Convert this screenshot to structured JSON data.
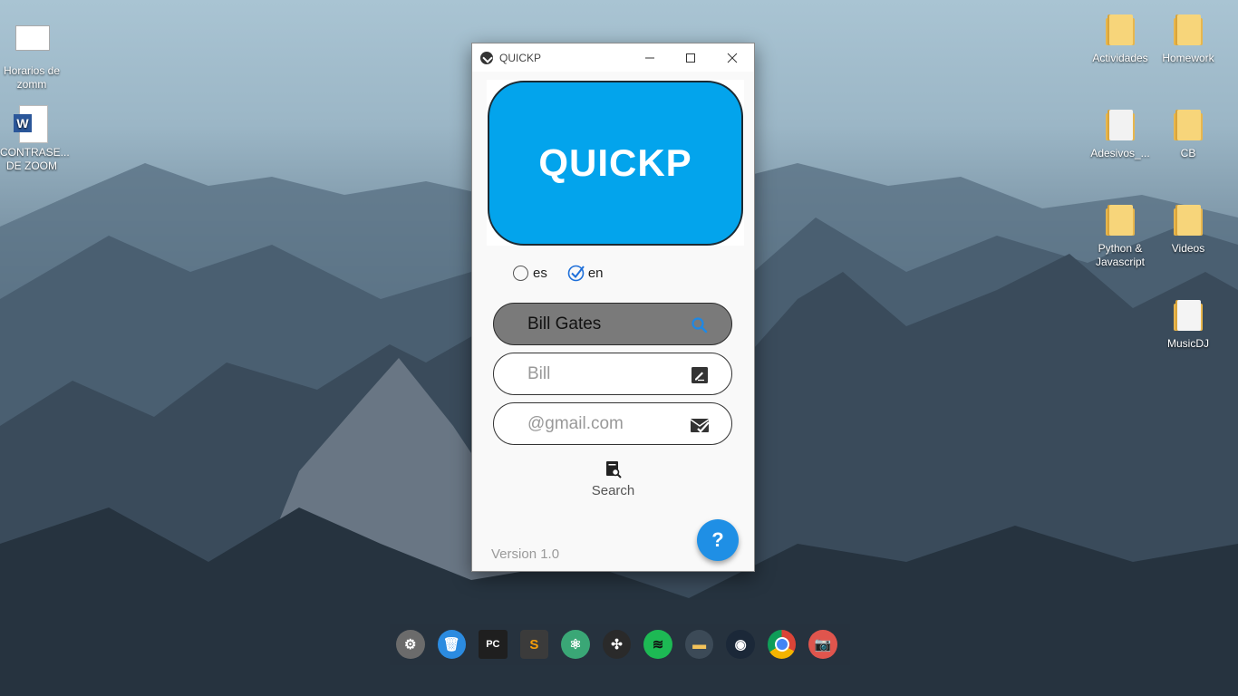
{
  "desktop": {
    "left_icons": [
      {
        "label": "Horarios de zomm",
        "icon": "document-icon"
      },
      {
        "label": "CONTRASE... DE ZOOM",
        "icon": "word-document-icon"
      }
    ],
    "right_icons": [
      {
        "label": "Actividades",
        "icon": "folder-icon"
      },
      {
        "label": "Homework",
        "icon": "folder-icon"
      },
      {
        "label": "Adesivos_...",
        "icon": "folder-icon"
      },
      {
        "label": "CB",
        "icon": "folder-icon"
      },
      {
        "label": "Python & Javascript",
        "icon": "folder-icon"
      },
      {
        "label": "Videos",
        "icon": "folder-icon"
      },
      {
        "label": "MusicDJ",
        "icon": "folder-icon"
      }
    ]
  },
  "window": {
    "title": "QUICKP",
    "logo_text": "QUICKP",
    "languages": [
      {
        "label": "es",
        "checked": false
      },
      {
        "label": "en",
        "checked": true
      }
    ],
    "search": {
      "value": "Bill Gates",
      "placeholder": ""
    },
    "name_field": {
      "value": "",
      "placeholder": "Bill"
    },
    "email_field": {
      "value": "",
      "placeholder": "@gmail.com"
    },
    "search_button_label": "Search",
    "version": "Version 1.0",
    "help_label": "?"
  },
  "dock": {
    "items": [
      {
        "name": "settings",
        "icon": "gear-icon",
        "color": "#6b6b6b"
      },
      {
        "name": "trash",
        "icon": "trash-icon",
        "color": "#2b8be0"
      },
      {
        "name": "pycharm",
        "icon": "pycharm-icon",
        "color": "#1f1f1f"
      },
      {
        "name": "sublime",
        "icon": "sublime-icon",
        "color": "#3b3b3b"
      },
      {
        "name": "atom",
        "icon": "atom-icon",
        "color": "#3aa776"
      },
      {
        "name": "davinci",
        "icon": "davinci-icon",
        "color": "#2a2a2a"
      },
      {
        "name": "spotify",
        "icon": "spotify-icon",
        "color": "#1db954"
      },
      {
        "name": "files",
        "icon": "folder-icon",
        "color": "#3c4a57"
      },
      {
        "name": "steam",
        "icon": "steam-icon",
        "color": "#1b2838"
      },
      {
        "name": "chrome",
        "icon": "chrome-icon",
        "color": "#e8e8e8"
      },
      {
        "name": "camera",
        "icon": "camera-icon",
        "color": "#e0554d"
      }
    ]
  },
  "colors": {
    "logo_bg": "#03a4ec",
    "fab_bg": "#1f8fe5",
    "search_icon": "#1e88e5"
  }
}
